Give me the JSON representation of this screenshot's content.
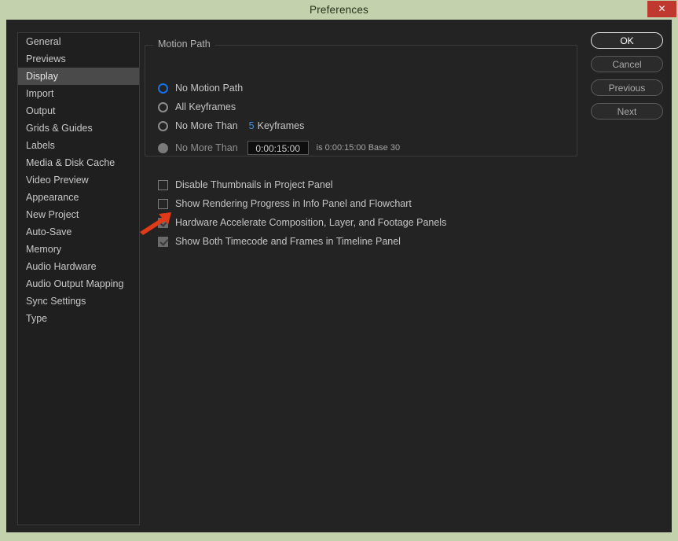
{
  "window": {
    "title": "Preferences",
    "close_label": "✕",
    "close_color": "#c0392f",
    "title_bar_color": "#c3d1ad",
    "body_color": "#232323"
  },
  "sidebar": {
    "selected": "Display",
    "items": [
      {
        "label": "General"
      },
      {
        "label": "Previews"
      },
      {
        "label": "Display"
      },
      {
        "label": "Import"
      },
      {
        "label": "Output"
      },
      {
        "label": "Grids & Guides"
      },
      {
        "label": "Labels"
      },
      {
        "label": "Media & Disk Cache"
      },
      {
        "label": "Video Preview"
      },
      {
        "label": "Appearance"
      },
      {
        "label": "New Project"
      },
      {
        "label": "Auto-Save"
      },
      {
        "label": "Memory"
      },
      {
        "label": "Audio Hardware"
      },
      {
        "label": "Audio Output Mapping"
      },
      {
        "label": "Sync Settings"
      },
      {
        "label": "Type"
      }
    ]
  },
  "motion_path": {
    "legend": "Motion Path",
    "accent_color": "#1473e6",
    "hot_text_color": "#4a8fdb",
    "options": [
      {
        "label": "No Motion Path",
        "selected": true,
        "disabled": false
      },
      {
        "label": "All Keyframes",
        "selected": false,
        "disabled": false
      },
      {
        "label": "No More Than",
        "selected": false,
        "disabled": false,
        "value": "5",
        "suffix": "Keyframes"
      },
      {
        "label": "No More Than",
        "selected": false,
        "disabled": true,
        "input_value": "0:00:15:00",
        "note": "is 0:00:15:00  Base 30"
      }
    ]
  },
  "checkboxes": [
    {
      "label": "Disable Thumbnails in Project Panel",
      "checked": false
    },
    {
      "label": "Show Rendering Progress in Info Panel and Flowchart",
      "checked": false
    },
    {
      "label": "Hardware Accelerate Composition, Layer, and Footage Panels",
      "checked": true
    },
    {
      "label": "Show Both Timecode and Frames in Timeline Panel",
      "checked": true
    }
  ],
  "actions": [
    {
      "label": "OK",
      "primary": true
    },
    {
      "label": "Cancel",
      "primary": false
    },
    {
      "label": "Previous",
      "primary": false
    },
    {
      "label": "Next",
      "primary": false
    }
  ],
  "annotation": {
    "arrow_color": "#e03a18",
    "points_at": "Hardware Accelerate Composition, Layer, and Footage Panels"
  }
}
